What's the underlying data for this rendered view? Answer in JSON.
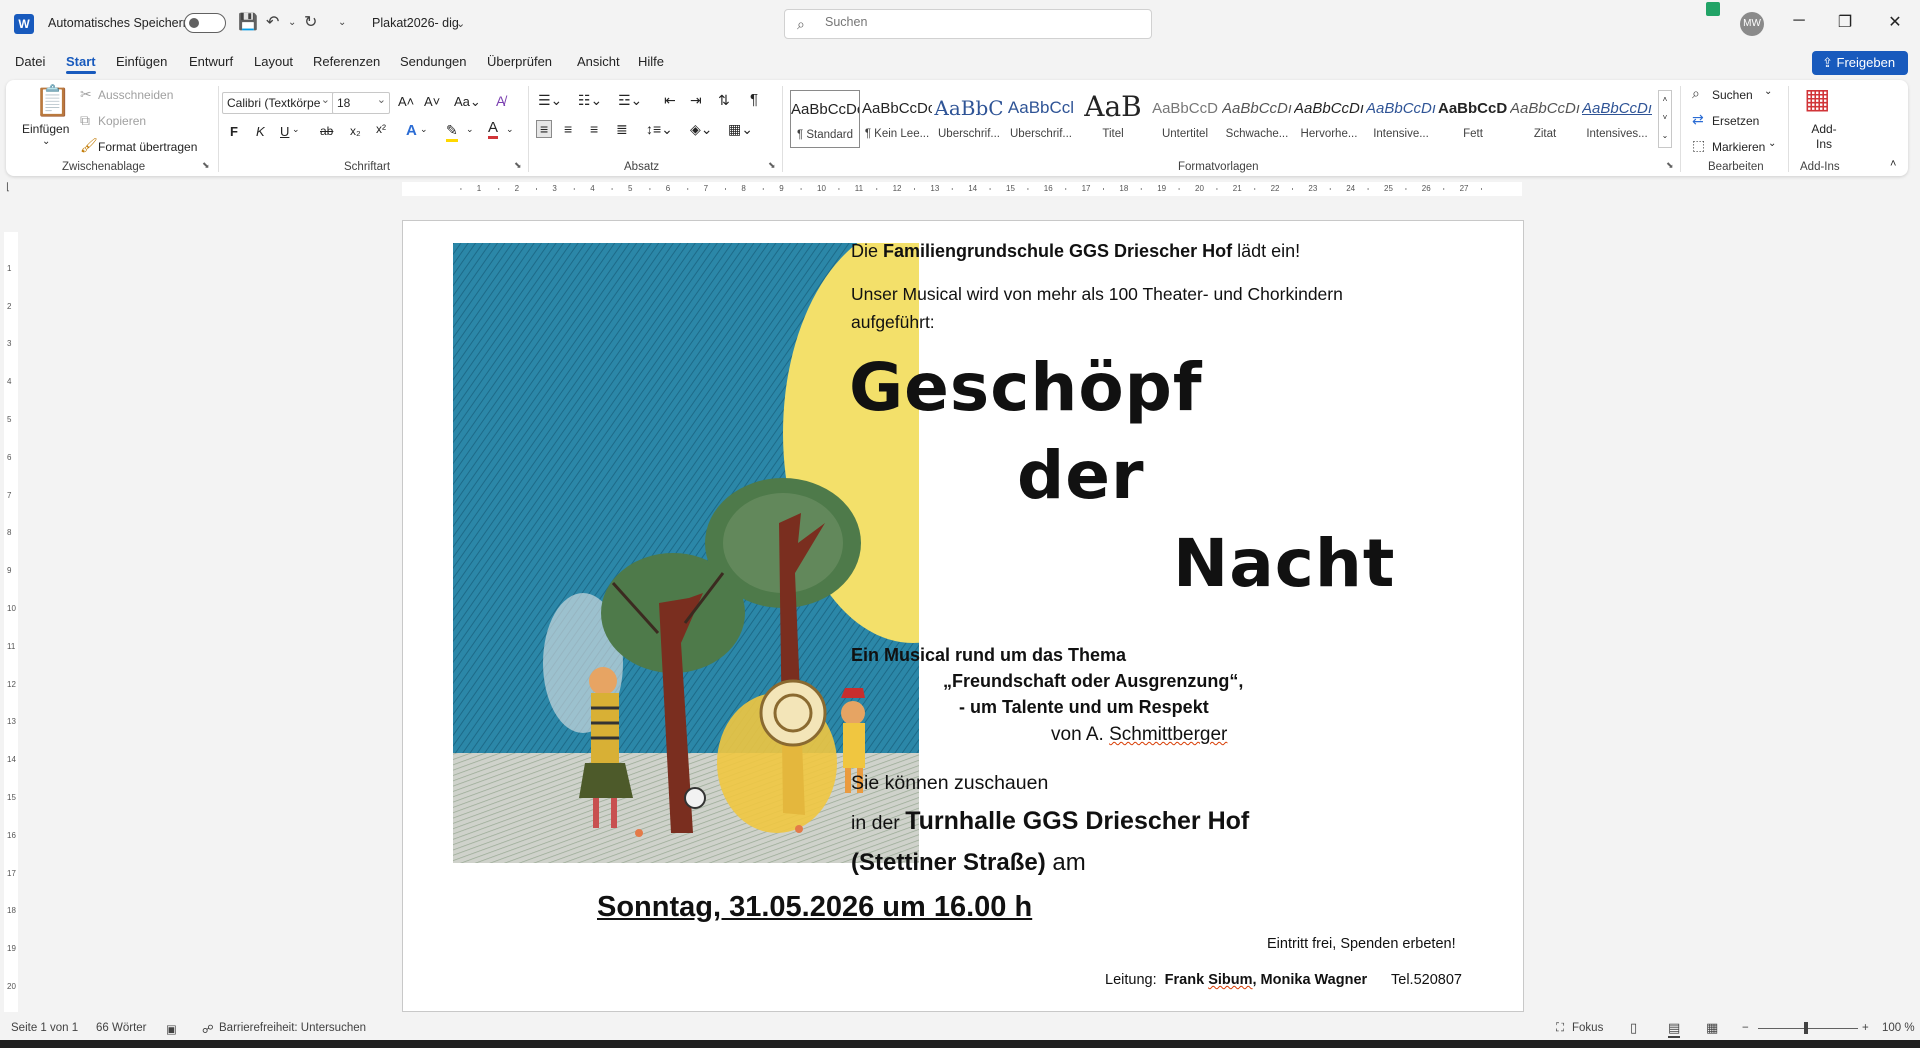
{
  "titlebar": {
    "autosave_label": "Automatisches Speichern",
    "document_name": "Plakat2026- dig",
    "search_placeholder": "Suchen",
    "user_initials": "MW"
  },
  "menu": {
    "items": [
      "Datei",
      "Start",
      "Einfügen",
      "Entwurf",
      "Layout",
      "Referenzen",
      "Sendungen",
      "Überprüfen",
      "Ansicht",
      "Hilfe"
    ],
    "active": "Start",
    "share_label": "Freigeben"
  },
  "ribbon": {
    "clipboard": {
      "paste": "Einfügen",
      "cut": "Ausschneiden",
      "copy": "Kopieren",
      "format_painter": "Format übertragen",
      "group_label": "Zwischenablage"
    },
    "font": {
      "font_name": "Calibri (Textkörpe",
      "font_size": "18",
      "bold": "F",
      "italic": "K",
      "underline": "U",
      "strike": "ab",
      "group_label": "Schriftart"
    },
    "paragraph": {
      "group_label": "Absatz"
    },
    "styles": {
      "group_label": "Formatvorlagen",
      "items": [
        {
          "preview": "AaBbCcDc",
          "name": "¶ Standard"
        },
        {
          "preview": "AaBbCcDc",
          "name": "¶ Kein Lee..."
        },
        {
          "preview": "AaBbC",
          "name": "Überschrif..."
        },
        {
          "preview": "AaBbCcl",
          "name": "Überschrif..."
        },
        {
          "preview": "AaB",
          "name": "Titel"
        },
        {
          "preview": "AaBbCcD",
          "name": "Untertitel"
        },
        {
          "preview": "AaBbCcDı",
          "name": "Schwache..."
        },
        {
          "preview": "AaBbCcDı",
          "name": "Hervorhe..."
        },
        {
          "preview": "AaBbCcDı",
          "name": "Intensive..."
        },
        {
          "preview": "AaBbCcDı",
          "name": "Fett"
        },
        {
          "preview": "AaBbCcDı",
          "name": "Zitat"
        },
        {
          "preview": "AaBbCcDı",
          "name": "Intensives..."
        }
      ]
    },
    "editing": {
      "find": "Suchen",
      "replace": "Ersetzen",
      "select": "Markieren",
      "group_label": "Bearbeiten"
    },
    "addins": {
      "label": "Add-Ins",
      "group_label": "Add-Ins"
    }
  },
  "document": {
    "line1_prefix": "Die ",
    "line1_bold": "Familiengrundschule GGS Driescher Hof",
    "line1_suffix": " lädt ein!",
    "line2": "Unser Musical wird von mehr als 100 Theater- und Chorkindern",
    "line3": "aufgeführt:",
    "title_1": "Geschöpf",
    "title_2": "der",
    "title_3": "Nacht",
    "theme_1": "Ein Musical rund um das Thema",
    "theme_2": "„Freundschaft  oder Ausgrenzung“,",
    "theme_3": "- um Talente und um Respekt",
    "author_prefix": "von A. ",
    "author_name": "Schmittberger",
    "watch_1": "Sie können zuschauen",
    "watch_2_prefix": "in der ",
    "watch_2_bold": "Turnhalle GGS Driescher Hof",
    "watch_3_bold": "(Stettiner Straße)",
    "watch_3_suffix": " am",
    "date_line": "Sonntag, 31.05.2026 um 16.00 h",
    "entry": "Eintritt frei, Spenden erbeten!",
    "lead_label": "Leitung:",
    "lead_names_1": "Frank ",
    "lead_names_sp": "Sibum",
    "lead_names_2": ", Monika Wagner",
    "phone": "Tel.520807"
  },
  "status": {
    "page": "Seite 1 von 1",
    "words": "66 Wörter",
    "accessibility": "Barrierefreiheit: Untersuchen",
    "focus": "Fokus",
    "zoom": "100 %"
  },
  "ruler_numbers": [
    "1",
    "2",
    "3",
    "4",
    "5",
    "6",
    "7",
    "8",
    "9",
    "10",
    "11",
    "12",
    "13",
    "14",
    "15",
    "16",
    "17",
    "18",
    "19",
    "20",
    "21",
    "22",
    "23",
    "24",
    "25",
    "26",
    "27"
  ]
}
